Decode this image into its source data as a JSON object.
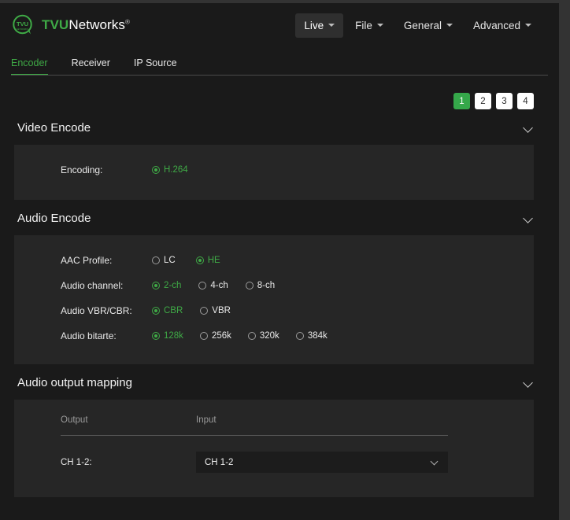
{
  "brand": {
    "logo_icon": "tvu-circle-logo-icon",
    "name_bold": "TVU",
    "name_light": "Networks",
    "trademark": "®"
  },
  "topnav": {
    "items": [
      {
        "label": "Live",
        "active": true
      },
      {
        "label": "File",
        "active": false
      },
      {
        "label": "General",
        "active": false
      },
      {
        "label": "Advanced",
        "active": false
      }
    ]
  },
  "tabs": {
    "items": [
      {
        "label": "Encoder",
        "active": true
      },
      {
        "label": "Receiver",
        "active": false
      },
      {
        "label": "IP Source",
        "active": false
      }
    ]
  },
  "pager": {
    "pages": [
      "1",
      "2",
      "3",
      "4"
    ],
    "active": "1",
    "active_bg": "#35a84a"
  },
  "colors": {
    "accent_green": "#3faa46",
    "page_bg": "#1a1a1a",
    "panel_bg": "#262626"
  },
  "sections": {
    "video_encode": {
      "title": "Video Encode",
      "chevron_icon": "chevron-down-icon",
      "rows": [
        {
          "label": "Encoding:",
          "options": [
            {
              "label": "H.264",
              "selected": true
            }
          ]
        }
      ]
    },
    "audio_encode": {
      "title": "Audio Encode",
      "chevron_icon": "chevron-down-icon",
      "rows": [
        {
          "label": "AAC Profile:",
          "options": [
            {
              "label": "LC",
              "selected": false
            },
            {
              "label": "HE",
              "selected": true
            }
          ]
        },
        {
          "label": "Audio channel:",
          "options": [
            {
              "label": "2-ch",
              "selected": true
            },
            {
              "label": "4-ch",
              "selected": false
            },
            {
              "label": "8-ch",
              "selected": false
            }
          ]
        },
        {
          "label": "Audio VBR/CBR:",
          "options": [
            {
              "label": "CBR",
              "selected": true
            },
            {
              "label": "VBR",
              "selected": false
            }
          ]
        },
        {
          "label": "Audio bitarte:",
          "options": [
            {
              "label": "128k",
              "selected": true
            },
            {
              "label": "256k",
              "selected": false
            },
            {
              "label": "320k",
              "selected": false
            },
            {
              "label": "384k",
              "selected": false
            }
          ]
        }
      ]
    },
    "audio_output_mapping": {
      "title": "Audio output mapping",
      "chevron_icon": "chevron-down-icon",
      "columns": {
        "output": "Output",
        "input": "Input"
      },
      "rows": [
        {
          "output_label": "CH 1-2:",
          "input_value": "CH 1-2",
          "chevron_icon": "chevron-down-icon"
        }
      ]
    }
  }
}
